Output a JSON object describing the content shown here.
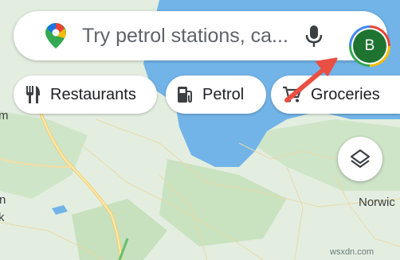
{
  "search": {
    "placeholder": "Try petrol stations, ca...",
    "account_initial": "B"
  },
  "chips": [
    {
      "label": "Restaurants",
      "icon": "fork-knife-icon"
    },
    {
      "label": "Petrol",
      "icon": "fuel-pump-icon"
    },
    {
      "label": "Groceries",
      "icon": "shopping-cart-icon"
    }
  ],
  "map": {
    "labels": {
      "norwich": "Norwic",
      "edge_m": "m",
      "edge_n": "n",
      "edge_k": "k"
    }
  },
  "watermark": "wsxdn.com",
  "colors": {
    "land": "#d9ead3",
    "water": "#72b4e8",
    "road": "#f6d27a",
    "arrow": "#e94f43",
    "avatar": "#1e7330"
  }
}
